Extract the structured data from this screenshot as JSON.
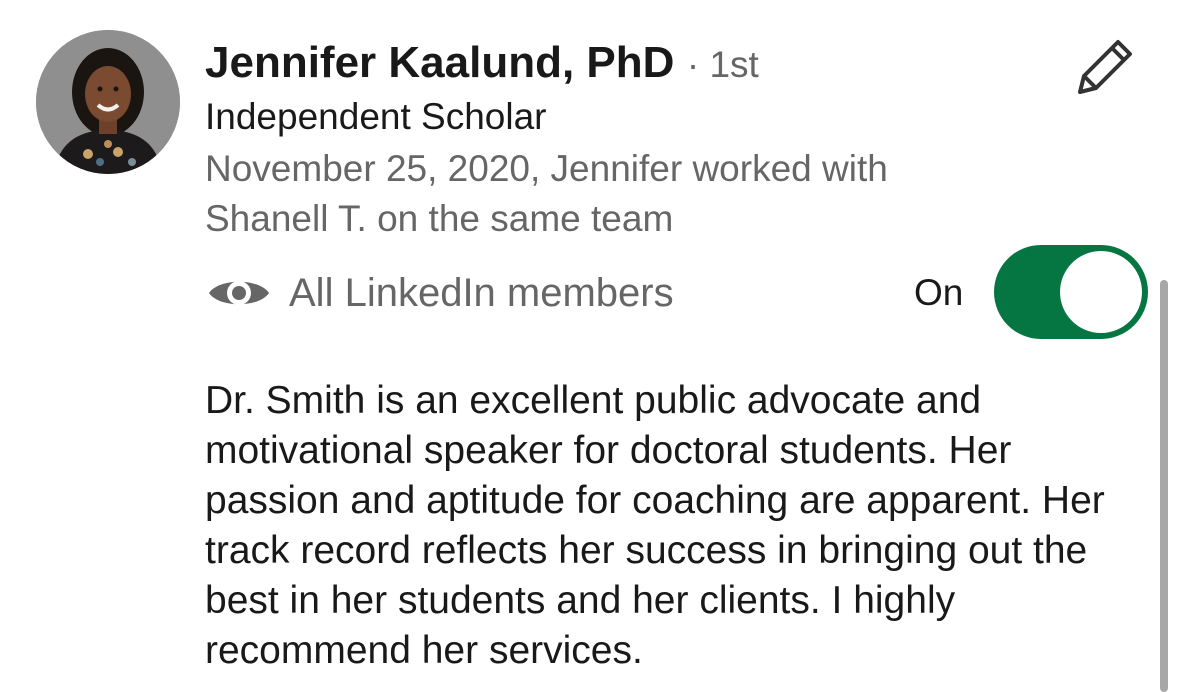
{
  "recommendation": {
    "author_name": "Jennifer Kaalund, PhD",
    "connection_degree": "· 1st",
    "headline": "Independent Scholar",
    "date_relationship": "November 25, 2020, Jennifer worked with Shanell T. on the same team",
    "visibility_label": "All LinkedIn members",
    "visibility_toggle_state": "On",
    "text": "Dr. Smith is an excellent public advocate and motivational speaker for doctoral students. Her passion and aptitude for coaching are apparent. Her track record reflects her success in bringing out the best in her students and her clients. I highly recommend her services."
  },
  "icons": {
    "edit": "pencil-icon",
    "visibility": "eye-icon"
  },
  "colors": {
    "toggle_on": "#057642",
    "secondary_text": "#666666",
    "primary_text": "#191919"
  }
}
